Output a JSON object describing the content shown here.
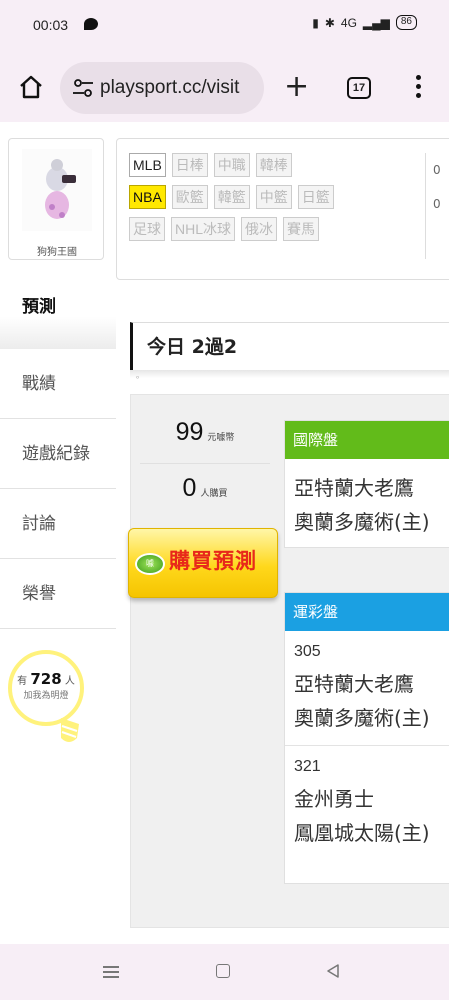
{
  "status": {
    "time": "00:03",
    "network": "4G",
    "battery": "86"
  },
  "browser": {
    "url": "playsport.cc/visit",
    "tab_count": "17"
  },
  "profile": {
    "name": "狗狗王國"
  },
  "sports": {
    "rows": [
      [
        "MLB",
        "日棒",
        "中職",
        "韓棒"
      ],
      [
        "NBA",
        "歐籃",
        "韓籃",
        "中籃",
        "日籃"
      ],
      [
        "足球",
        "NHL冰球",
        "俄冰",
        "賽馬"
      ]
    ],
    "active": "NBA",
    "side_labels": [
      "0",
      "0"
    ]
  },
  "nav": {
    "items": [
      "預測",
      "戰績",
      "遊戲紀錄",
      "討論",
      "榮譽"
    ],
    "active": "預測"
  },
  "fans": {
    "prefix": "有",
    "count": "728",
    "suffix": "人",
    "caption": "加我為明燈"
  },
  "today": {
    "title": "今日 2過2",
    "mark": "ᵒ"
  },
  "stats": {
    "price": "99",
    "price_unit": "元噱幣",
    "buyers": "0",
    "buyers_unit": "人購買"
  },
  "buy_button": {
    "coin_label": "噱",
    "label": "購買預測"
  },
  "international": {
    "header": "國際盤",
    "teams": [
      "亞特蘭大老鷹",
      "奧蘭多魔術(主)"
    ]
  },
  "lottery": {
    "header": "運彩盤",
    "games": [
      {
        "number": "305",
        "teams": [
          "亞特蘭大老鷹",
          "奧蘭多魔術(主)"
        ]
      },
      {
        "number": "321",
        "teams": [
          "金州勇士",
          "鳳凰城太陽(主)"
        ]
      }
    ]
  },
  "colors": {
    "intl_header": "#62bb1a",
    "lottery_header": "#1ba0e2",
    "active_tag": "#ffe800",
    "buy_text": "#e8281a"
  }
}
